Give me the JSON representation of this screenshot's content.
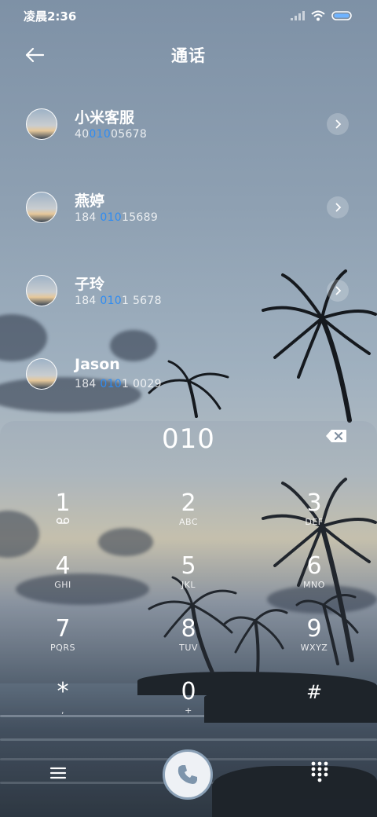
{
  "status_bar": {
    "time": "凌晨2:36"
  },
  "header": {
    "title": "通话"
  },
  "contacts": [
    {
      "name": "小米客服",
      "number_pre": "40",
      "number_match": "010",
      "number_post": "05678"
    },
    {
      "name": "燕婷",
      "number_pre": "184 ",
      "number_match": "010",
      "number_post": "15689"
    },
    {
      "name": "子玲",
      "number_pre": "184 ",
      "number_match": "010",
      "number_post": "1 5678"
    },
    {
      "name": "Jason",
      "number_pre": "184 ",
      "number_match": "010",
      "number_post": "1 0029"
    }
  ],
  "dialpad": {
    "input": "010",
    "keys": [
      {
        "digit": "1",
        "letters": ""
      },
      {
        "digit": "2",
        "letters": "ABC"
      },
      {
        "digit": "3",
        "letters": "DEF"
      },
      {
        "digit": "4",
        "letters": "GHI"
      },
      {
        "digit": "5",
        "letters": "JKL"
      },
      {
        "digit": "6",
        "letters": "MNO"
      },
      {
        "digit": "7",
        "letters": "PQRS"
      },
      {
        "digit": "8",
        "letters": "TUV"
      },
      {
        "digit": "9",
        "letters": "WXYZ"
      },
      {
        "digit": "*",
        "letters": ","
      },
      {
        "digit": "0",
        "letters": "+"
      },
      {
        "digit": "#",
        "letters": ""
      }
    ]
  },
  "icons": {
    "back": "back-arrow-icon",
    "detail": "chevron-right-icon",
    "delete": "backspace-icon",
    "voicemail": "voicemail-icon",
    "menu": "menu-icon",
    "call": "phone-icon",
    "keypad": "keypad-icon"
  },
  "colors": {
    "match_highlight": "#2f8cf2"
  }
}
